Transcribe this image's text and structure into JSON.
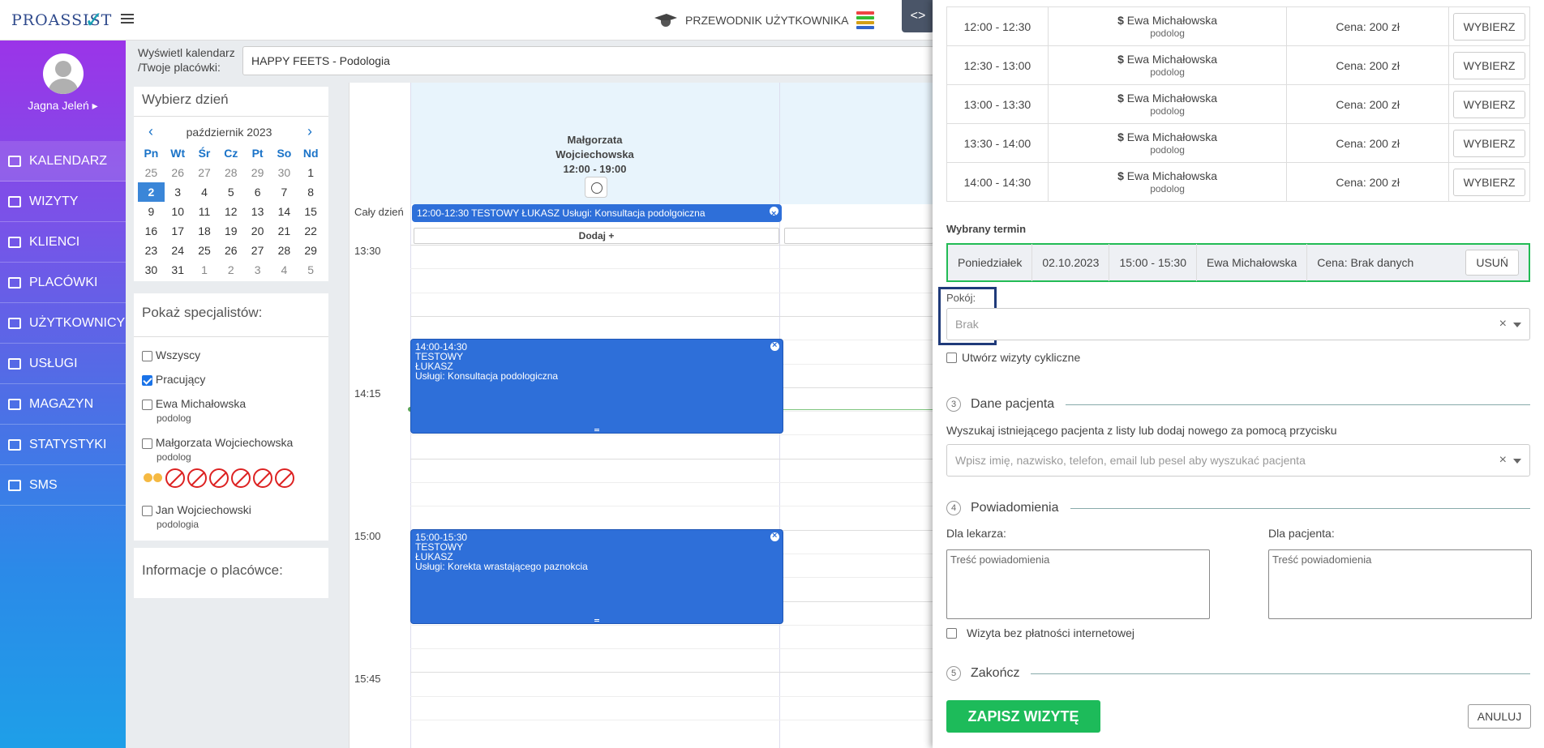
{
  "app": {
    "logo": "PROASSIST",
    "user_name": "Jagna Jeleń ▸"
  },
  "header": {
    "guide_label": "PRZEWODNIK UŻYTKOWNIKA",
    "toggle_label": "<>"
  },
  "nav": [
    {
      "label": "KALENDARZ",
      "icon": "calendar-icon"
    },
    {
      "label": "WIZYTY",
      "icon": "list-icon"
    },
    {
      "label": "KLIENCI",
      "icon": "users-icon"
    },
    {
      "label": "PLACÓWKI",
      "icon": "user-plus-icon"
    },
    {
      "label": "UŻYTKOWNICY",
      "icon": "user-circle-icon"
    },
    {
      "label": "USŁUGI",
      "icon": "grid-icon"
    },
    {
      "label": "MAGAZYN",
      "icon": "box-icon"
    },
    {
      "label": "STATYSTYKI",
      "icon": "bar-chart-icon"
    },
    {
      "label": "SMS",
      "icon": "message-icon"
    }
  ],
  "location": {
    "label_line1": "Wyświetl kalendarz",
    "label_line2": "/Twoje placówki:",
    "value": "HAPPY FEETS - Podologia"
  },
  "datepicker": {
    "title": "Wybierz dzień",
    "month": "październik 2023",
    "prev": "‹",
    "next": "›",
    "weekdays": [
      "Pn",
      "Wt",
      "Śr",
      "Cz",
      "Pt",
      "So",
      "Nd"
    ],
    "weeks": [
      [
        "25",
        "26",
        "27",
        "28",
        "29",
        "30",
        "1"
      ],
      [
        "2",
        "3",
        "4",
        "5",
        "6",
        "7",
        "8"
      ],
      [
        "9",
        "10",
        "11",
        "12",
        "13",
        "14",
        "15"
      ],
      [
        "16",
        "17",
        "18",
        "19",
        "20",
        "21",
        "22"
      ],
      [
        "23",
        "24",
        "25",
        "26",
        "27",
        "28",
        "29"
      ],
      [
        "30",
        "31",
        "1",
        "2",
        "3",
        "4",
        "5"
      ]
    ]
  },
  "specialists": {
    "title": "Pokaż specjalistów:",
    "items": [
      {
        "name": "Wszyscy",
        "role": "",
        "checked": false
      },
      {
        "name": "Pracujący",
        "role": "",
        "checked": true
      },
      {
        "name": "Ewa Michałowska",
        "role": "podolog",
        "checked": false
      },
      {
        "name": "Małgorzata Wojciechowska",
        "role": "podolog",
        "checked": false
      },
      {
        "name": "Jan Wojciechowski",
        "role": "podologia",
        "checked": false
      }
    ]
  },
  "facility_info": {
    "title": "Informacje o placówce:"
  },
  "calendar": {
    "specialist_line1": "Małgorzata",
    "specialist_line2": "Wojciechowska",
    "hours": "12:00 - 19:00",
    "allday_label": "Cały dzień",
    "allday_event": "12:00-12:30 TESTOWY ŁUKASZ Usługi: Konsultacja podolgoiczna",
    "add_label": "Dodaj +",
    "time_labels": [
      "13:30",
      "14:15",
      "15:00",
      "15:45"
    ],
    "events": [
      {
        "time": "14:00-14:30",
        "line1": "TESTOWY",
        "line2": "ŁUKASZ",
        "service": "Usługi: Konsultacja podologiczna"
      },
      {
        "time": "15:00-15:30",
        "line1": "TESTOWY",
        "line2": "ŁUKASZ",
        "service": "Usługi: Korekta wrastającego paznokcia"
      }
    ]
  },
  "modal": {
    "slots": [
      {
        "time": "12:00 - 12:30",
        "name": "Ewa Michałowska",
        "role": "podolog",
        "price": "Cena: 200 zł",
        "button": "WYBIERZ"
      },
      {
        "time": "12:30 - 13:00",
        "name": "Ewa Michałowska",
        "role": "podolog",
        "price": "Cena: 200 zł",
        "button": "WYBIERZ"
      },
      {
        "time": "13:00 - 13:30",
        "name": "Ewa Michałowska",
        "role": "podolog",
        "price": "Cena: 200 zł",
        "button": "WYBIERZ"
      },
      {
        "time": "13:30 - 14:00",
        "name": "Ewa Michałowska",
        "role": "podolog",
        "price": "Cena: 200 zł",
        "button": "WYBIERZ"
      },
      {
        "time": "14:00 - 14:30",
        "name": "Ewa Michałowska",
        "role": "podolog",
        "price": "Cena: 200 zł",
        "button": "WYBIERZ"
      }
    ],
    "chosen_title": "Wybrany termin",
    "chosen": {
      "day": "Poniedziałek",
      "date": "02.10.2023",
      "time": "15:00 - 15:30",
      "name": "Ewa Michałowska",
      "price": "Cena: Brak danych",
      "remove": "USUŃ"
    },
    "room_label": "Pokój:",
    "room_value": "Brak",
    "cyclic_label": "Utwórz wizyty cykliczne",
    "step3": {
      "num": "3",
      "title": "Dane pacjenta"
    },
    "patient_hint": "Wyszukaj istniejącego pacjenta z listy lub dodaj nowego za pomocą przycisku",
    "patient_placeholder": "Wpisz imię, nazwisko, telefon, email lub pesel aby wyszukać pacjenta",
    "step4": {
      "num": "4",
      "title": "Powiadomienia"
    },
    "doctor_label": "Dla lekarza:",
    "patient_label": "Dla pacjenta:",
    "notify_placeholder": "Treść powiadomienia",
    "no_payment_label": "Wizyta bez płatności internetowej",
    "step5": {
      "num": "5",
      "title": "Zakończ"
    },
    "save": "ZAPISZ WIZYTĘ",
    "cancel": "ANULUJ",
    "x": "×"
  },
  "colors": {
    "accent": "#2e6fd9",
    "success": "#1dbb5a",
    "highlight": "#1f3a7a"
  }
}
